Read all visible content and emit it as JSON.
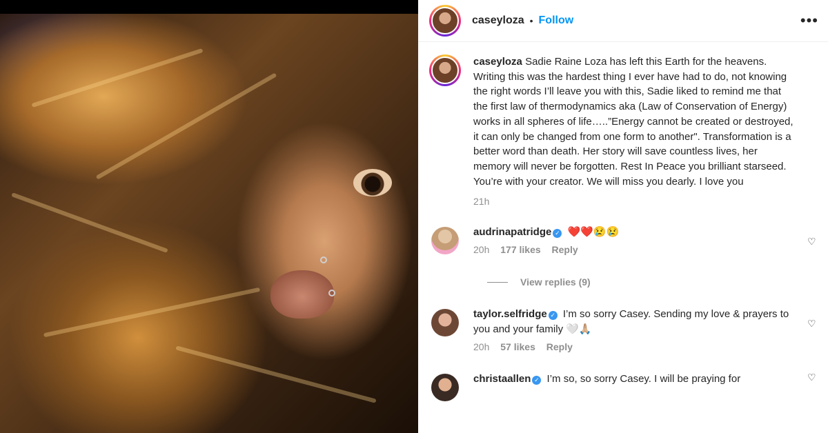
{
  "post": {
    "username": "caseyloza",
    "separator": "•",
    "follow_label": "Follow",
    "more_icon": "more-horizontal-icon",
    "caption": {
      "username": "caseyloza",
      "text": "Sadie Raine Loza has left this Earth for the heavens. Writing this was the hardest thing I ever have had to do, not knowing the right words I’ll leave you with this, Sadie liked to remind me that the first law of thermodynamics aka (Law of Conservation of Energy) works in all spheres of life…..”Energy cannot be created or destroyed, it can only be changed from one form to another\". Transformation is a better word than death. Her story will save countless lives, her memory will never be forgotten. Rest In Peace you brilliant starseed. You’re with your creator. We will miss you dearly. I love you",
      "time": "21h"
    }
  },
  "comments": [
    {
      "username": "audrinapatridge",
      "verified": true,
      "text": "❤️❤️😢😢",
      "time": "20h",
      "likes": "177 likes",
      "reply_label": "Reply"
    },
    {
      "username": "taylor.selfridge",
      "verified": true,
      "text": "I’m so sorry Casey. Sending my love & prayers to you and your family 🤍🙏🏼",
      "time": "20h",
      "likes": "57 likes",
      "reply_label": "Reply"
    },
    {
      "username": "christaallen",
      "verified": true,
      "text": "I’m so, so sorry Casey. I will be praying for"
    }
  ],
  "view_replies_label": "View replies (9)",
  "colors": {
    "accent": "#0095f6",
    "secondary_text": "#8e8e8e",
    "verified": "#3897f0"
  }
}
